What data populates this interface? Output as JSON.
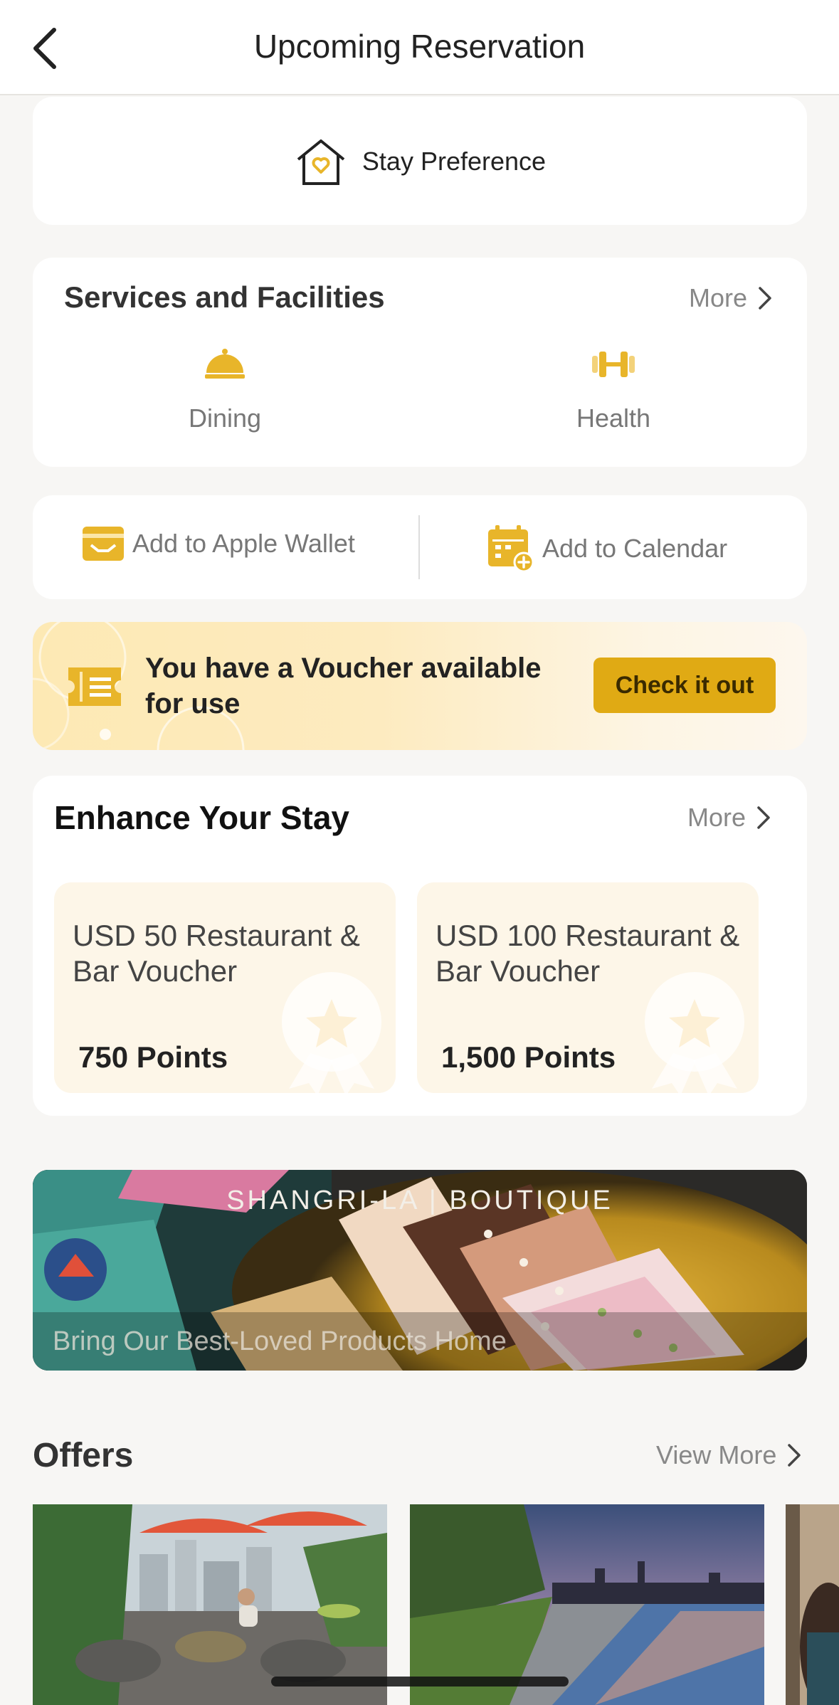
{
  "header": {
    "title": "Upcoming Reservation"
  },
  "stay_preference": {
    "label": "Stay Preference"
  },
  "services": {
    "title": "Services and Facilities",
    "more_label": "More",
    "items": [
      {
        "label": "Dining",
        "icon": "dining-cloche-icon"
      },
      {
        "label": "Health",
        "icon": "dumbbell-icon"
      }
    ]
  },
  "actions": {
    "wallet_label": "Add to Apple Wallet",
    "calendar_label": "Add to Calendar"
  },
  "voucher": {
    "text": "You have a Voucher available for use",
    "button_label": "Check it out"
  },
  "enhance": {
    "title": "Enhance Your Stay",
    "more_label": "More",
    "rewards": [
      {
        "name": "USD 50 Restaurant & Bar Voucher",
        "points": "750 Points"
      },
      {
        "name": "USD 100 Restaurant & Bar Voucher",
        "points": "1,500 Points"
      }
    ]
  },
  "boutique": {
    "brand": "SHANGRI-LA | BOUTIQUE",
    "tagline": "Bring Our Best-Loved Products Home"
  },
  "offers": {
    "title": "Offers",
    "view_more_label": "View More"
  },
  "colors": {
    "accent": "#e0aa14",
    "icon_gold": "#e8b52a",
    "background": "#f7f6f4"
  }
}
